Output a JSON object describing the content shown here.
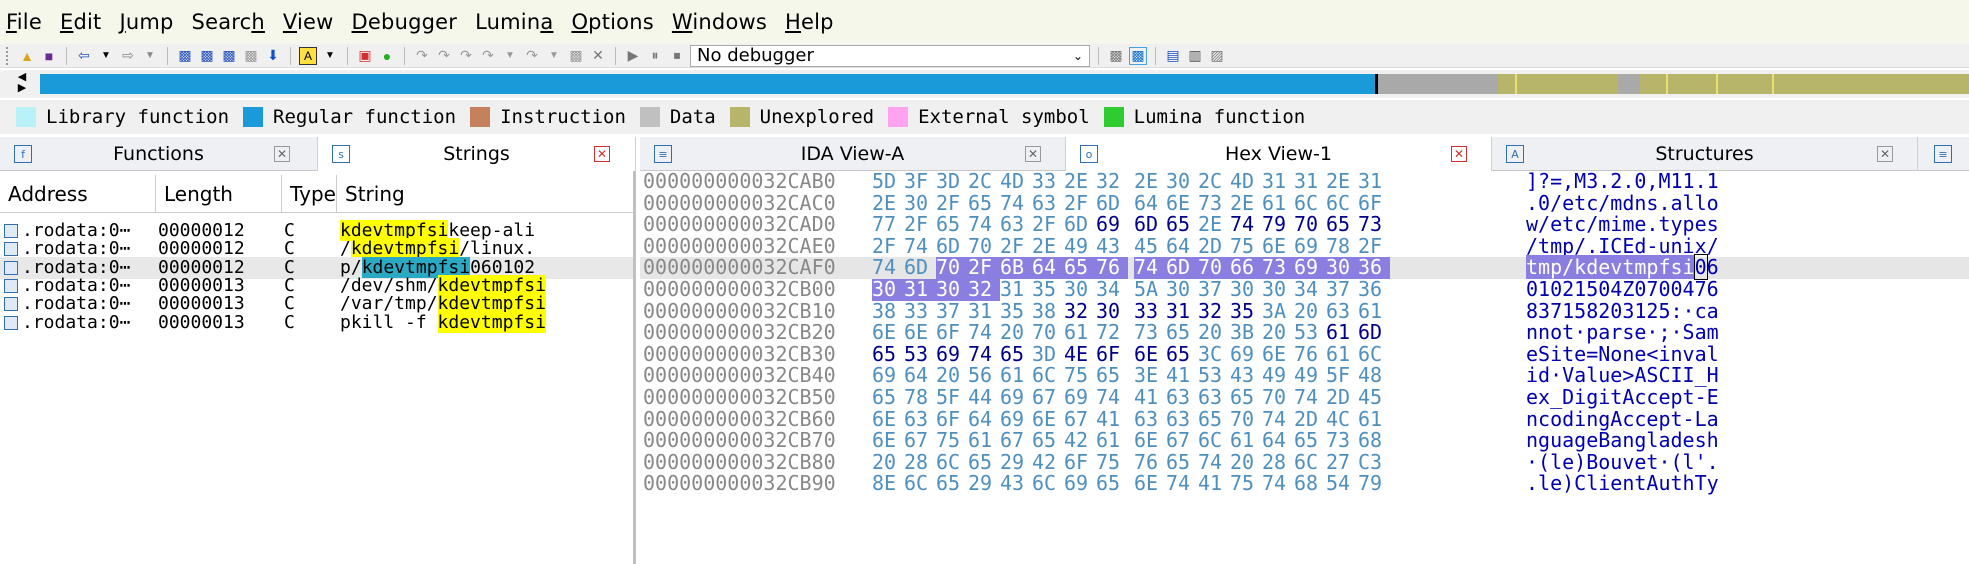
{
  "menu": [
    "File",
    "Edit",
    "Jump",
    "Search",
    "View",
    "Debugger",
    "Lumina",
    "Options",
    "Windows",
    "Help"
  ],
  "menu_underline_index": [
    0,
    0,
    0,
    5,
    0,
    0,
    5,
    0,
    0,
    0
  ],
  "toolbar": {
    "debugger_value": "No debugger",
    "icons": [
      "open-icon",
      "save-icon",
      "back-icon",
      "forward-icon",
      "hex-search-icon",
      "text-search-icon",
      "binary-search-icon",
      "next-code-icon",
      "name-icon",
      "breakpoint-icon",
      "start-icon",
      "run-icon",
      "pause-icon",
      "stop-icon"
    ]
  },
  "legend": [
    {
      "label": "Library function",
      "color": "#b8f2f8"
    },
    {
      "label": "Regular function",
      "color": "#1a9ad8"
    },
    {
      "label": "Instruction",
      "color": "#c5805c"
    },
    {
      "label": "Data",
      "color": "#c0c0c0"
    },
    {
      "label": "Unexplored",
      "color": "#b7b56a"
    },
    {
      "label": "External symbol",
      "color": "#ffa3f1"
    },
    {
      "label": "Lumina function",
      "color": "#2ecc30"
    }
  ],
  "tabs": {
    "functions": "Functions",
    "strings": "Strings",
    "ida_view": "IDA View-A",
    "hex_view": "Hex View-1",
    "structures": "Structures"
  },
  "strings_table": {
    "columns": [
      "Address",
      "Length",
      "Type",
      "String"
    ],
    "rows": [
      {
        "address": ".rodata:0⋯",
        "length": "00000012",
        "type": "C",
        "pre": "",
        "match": "kdevtmpfsi",
        "post": "keep-ali",
        "selected": false
      },
      {
        "address": ".rodata:0⋯",
        "length": "00000012",
        "type": "C",
        "pre": "/",
        "match": "kdevtmpfsi",
        "post": "/linux.",
        "selected": false
      },
      {
        "address": ".rodata:0⋯",
        "length": "00000012",
        "type": "C",
        "pre": "p/",
        "match": "kdevtmpfsi",
        "post": "060102",
        "selected": true
      },
      {
        "address": ".rodata:0⋯",
        "length": "00000013",
        "type": "C",
        "pre": "/dev/shm/",
        "match": "kdevtmpfsi",
        "post": "",
        "selected": false
      },
      {
        "address": ".rodata:0⋯",
        "length": "00000013",
        "type": "C",
        "pre": "/var/tmp/",
        "match": "kdevtmpfsi",
        "post": "",
        "selected": false
      },
      {
        "address": ".rodata:0⋯",
        "length": "00000013",
        "type": "C",
        "pre": "pkill -f ",
        "match": "kdevtmpfsi",
        "post": "",
        "selected": false
      }
    ]
  },
  "hex_view": {
    "rows": [
      {
        "addr": "000000000032CAB0",
        "bytes": [
          "5D",
          "3F",
          "3D",
          "2C",
          "4D",
          "33",
          "2E",
          "32",
          "2E",
          "30",
          "2C",
          "4D",
          "31",
          "31",
          "2E",
          "31"
        ],
        "ascii": "]?=,M3.2.0,M11.1"
      },
      {
        "addr": "000000000032CAC0",
        "bytes": [
          "2E",
          "30",
          "2F",
          "65",
          "74",
          "63",
          "2F",
          "6D",
          "64",
          "6E",
          "73",
          "2E",
          "61",
          "6C",
          "6C",
          "6F"
        ],
        "ascii": ".0/etc/mdns.allo"
      },
      {
        "addr": "000000000032CAD0",
        "bytes": [
          "77",
          "2F",
          "65",
          "74",
          "63",
          "2F",
          "6D",
          "69",
          "6D",
          "65",
          "2E",
          "74",
          "79",
          "70",
          "65",
          "73"
        ],
        "ascii": "w/etc/mime.types"
      },
      {
        "addr": "000000000032CAE0",
        "bytes": [
          "2F",
          "74",
          "6D",
          "70",
          "2F",
          "2E",
          "49",
          "43",
          "45",
          "64",
          "2D",
          "75",
          "6E",
          "69",
          "78",
          "2F"
        ],
        "ascii": "/tmp/.ICEd-unix/"
      },
      {
        "addr": "000000000032CAF0",
        "bytes": [
          "74",
          "6D",
          "70",
          "2F",
          "6B",
          "64",
          "65",
          "76",
          "74",
          "6D",
          "70",
          "66",
          "73",
          "69",
          "30",
          "36"
        ],
        "ascii": "tmp/kdevtmpfsi06"
      },
      {
        "addr": "000000000032CB00",
        "bytes": [
          "30",
          "31",
          "30",
          "32",
          "31",
          "35",
          "30",
          "34",
          "5A",
          "30",
          "37",
          "30",
          "30",
          "34",
          "37",
          "36"
        ],
        "ascii": "01021504Z0700476"
      },
      {
        "addr": "000000000032CB10",
        "bytes": [
          "38",
          "33",
          "37",
          "31",
          "35",
          "38",
          "32",
          "30",
          "33",
          "31",
          "32",
          "35",
          "3A",
          "20",
          "63",
          "61"
        ],
        "ascii": "837158203125:·ca"
      },
      {
        "addr": "000000000032CB20",
        "bytes": [
          "6E",
          "6E",
          "6F",
          "74",
          "20",
          "70",
          "61",
          "72",
          "73",
          "65",
          "20",
          "3B",
          "20",
          "53",
          "61",
          "6D"
        ],
        "ascii": "nnot·parse·;·Sam"
      },
      {
        "addr": "000000000032CB30",
        "bytes": [
          "65",
          "53",
          "69",
          "74",
          "65",
          "3D",
          "4E",
          "6F",
          "6E",
          "65",
          "3C",
          "69",
          "6E",
          "76",
          "61",
          "6C"
        ],
        "ascii": "eSite=None<inval"
      },
      {
        "addr": "000000000032CB40",
        "bytes": [
          "69",
          "64",
          "20",
          "56",
          "61",
          "6C",
          "75",
          "65",
          "3E",
          "41",
          "53",
          "43",
          "49",
          "49",
          "5F",
          "48"
        ],
        "ascii": "id·Value>ASCII_H"
      },
      {
        "addr": "000000000032CB50",
        "bytes": [
          "65",
          "78",
          "5F",
          "44",
          "69",
          "67",
          "69",
          "74",
          "41",
          "63",
          "63",
          "65",
          "70",
          "74",
          "2D",
          "45"
        ],
        "ascii": "ex_DigitAccept-E"
      },
      {
        "addr": "000000000032CB60",
        "bytes": [
          "6E",
          "63",
          "6F",
          "64",
          "69",
          "6E",
          "67",
          "41",
          "63",
          "63",
          "65",
          "70",
          "74",
          "2D",
          "4C",
          "61"
        ],
        "ascii": "ncodingAccept-La"
      },
      {
        "addr": "000000000032CB70",
        "bytes": [
          "6E",
          "67",
          "75",
          "61",
          "67",
          "65",
          "42",
          "61",
          "6E",
          "67",
          "6C",
          "61",
          "64",
          "65",
          "73",
          "68"
        ],
        "ascii": "nguageBangladesh"
      },
      {
        "addr": "000000000032CB80",
        "bytes": [
          "20",
          "28",
          "6C",
          "65",
          "29",
          "42",
          "6F",
          "75",
          "76",
          "65",
          "74",
          "20",
          "28",
          "6C",
          "27",
          "C3"
        ],
        "ascii": "·(le)Bouvet·(l'."
      },
      {
        "addr": "000000000032CB90",
        "bytes": [
          "8E",
          "6C",
          "65",
          "29",
          "43",
          "6C",
          "69",
          "65",
          "6E",
          "74",
          "41",
          "75",
          "74",
          "68",
          "54",
          "79"
        ],
        "ascii": ".le)ClientAuthTy"
      }
    ]
  }
}
